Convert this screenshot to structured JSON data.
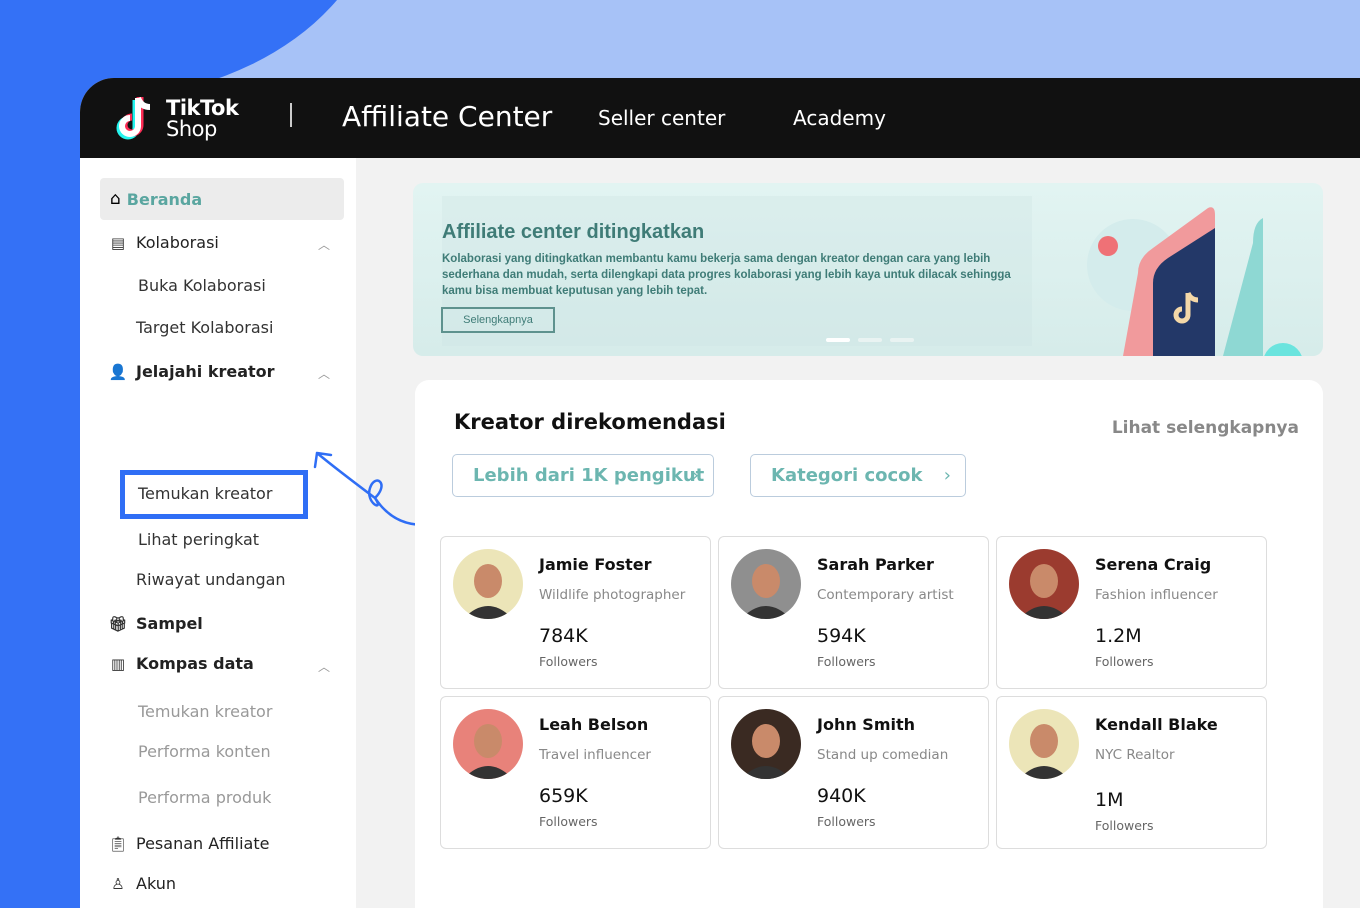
{
  "header": {
    "logo_line1": "TikTok",
    "logo_line2": "Shop",
    "title": "Affiliate Center",
    "nav": [
      "Seller center",
      "Academy"
    ]
  },
  "sidebar": {
    "beranda": "Beranda",
    "kolaborasi": "Kolaborasi",
    "buka": "Buka Kolaborasi",
    "target": "Target Kolaborasi",
    "jelajahi": "Jelajahi kreator",
    "temukan": "Temukan kreator",
    "peringkat": "Lihat peringkat",
    "riwayat": "Riwayat undangan",
    "sampel": "Sampel",
    "kompas": "Kompas data",
    "k_temukan": "Temukan kreator",
    "k_konten": "Performa konten",
    "k_produk": "Performa produk",
    "pesanan": "Pesanan Affiliate",
    "akun": "Akun"
  },
  "banner": {
    "title": "Affiliate center ditingkatkan",
    "desc": "Kolaborasi yang ditingkatkan membantu kamu bekerja sama dengan kreator dengan cara yang lebih sederhana dan mudah, serta dilengkapi data progres kolaborasi yang lebih kaya untuk dilacak sehingga kamu bisa membuat keputusan yang lebih tepat.",
    "button": "Selengkapnya"
  },
  "recommended": {
    "title": "Kreator direkomendasi",
    "see_more": "Lihat selengkapnya",
    "filters": [
      "Lebih dari 1K pengikut",
      "Kategori cocok"
    ],
    "creators": [
      {
        "name": "Jamie Foster",
        "role": "Wildlife photographer",
        "followers": "784K",
        "label": "Followers",
        "bg": "#ece5b8"
      },
      {
        "name": "Sarah Parker",
        "role": "Contemporary artist",
        "followers": "594K",
        "label": "Followers",
        "bg": "#8f8f8f"
      },
      {
        "name": "Serena Craig",
        "role": "Fashion influencer",
        "followers": "1.2M",
        "label": "Followers",
        "bg": "#9b3b2f"
      },
      {
        "name": "Leah Belson",
        "role": "Travel influencer",
        "followers": "659K",
        "label": "Followers",
        "bg": "#e8827a"
      },
      {
        "name": "John Smith",
        "role": "Stand up comedian",
        "followers": "940K",
        "label": "Followers",
        "bg": "#3a2a22"
      },
      {
        "name": "Kendall Blake",
        "role": "NYC Realtor",
        "followers": "1M",
        "label": "Followers",
        "bg": "#ece5b8"
      }
    ]
  }
}
